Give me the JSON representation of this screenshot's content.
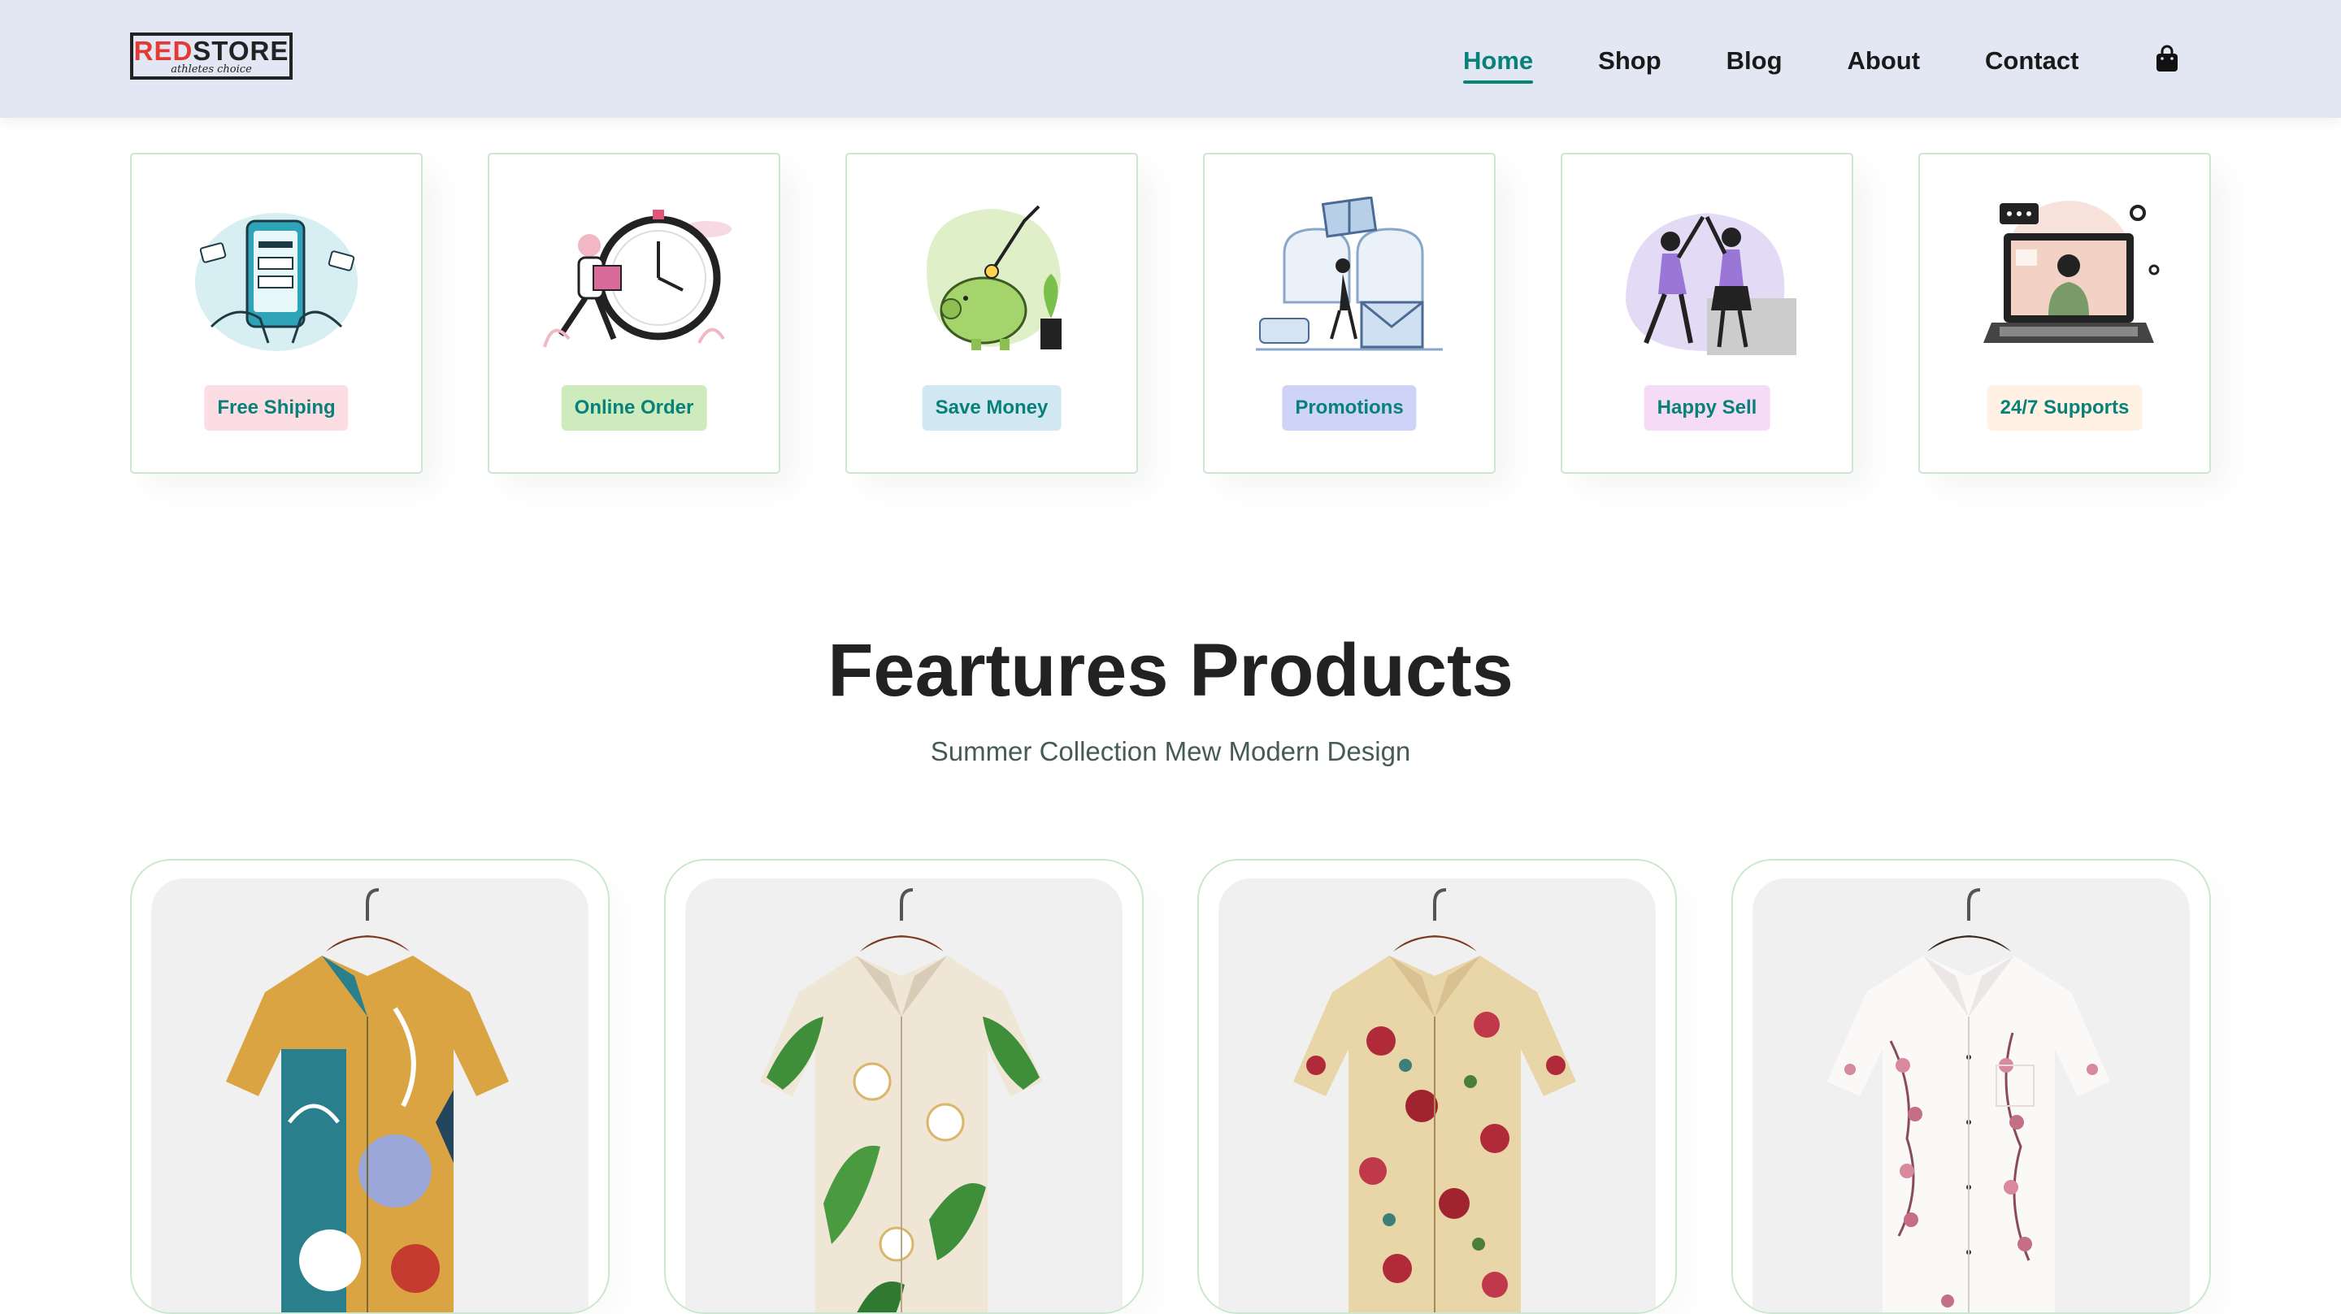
{
  "brand": {
    "logo_red": "RED",
    "logo_dark": "STORE",
    "logo_tagline": "athletes choice"
  },
  "nav": {
    "items": [
      "Home",
      "Shop",
      "Blog",
      "About",
      "Contact"
    ],
    "active": "Home",
    "cart_icon": "shopping-bag-icon"
  },
  "features": [
    {
      "label": "Free Shiping",
      "badge_color": "#fddde4",
      "icon": "phone-payment-illustration"
    },
    {
      "label": "Online Order",
      "badge_color": "#cdebbc",
      "icon": "stopwatch-delivery-illustration"
    },
    {
      "label": "Save Money",
      "badge_color": "#d1e8f2",
      "icon": "piggy-bank-illustration"
    },
    {
      "label": "Promotions",
      "badge_color": "#cdd4f8",
      "icon": "gift-promotion-illustration"
    },
    {
      "label": "Happy Sell",
      "badge_color": "#f6dbf6",
      "icon": "high-five-illustration"
    },
    {
      "label": "24/7 Supports",
      "badge_color": "#fff2e5",
      "icon": "laptop-support-illustration"
    }
  ],
  "section": {
    "title": "Feartures Products",
    "subtitle": "Summer Collection Mew Modern Design"
  },
  "products": [
    {
      "image": "abstract-print-shirt"
    },
    {
      "image": "tropical-leaf-shirt"
    },
    {
      "image": "floral-rose-shirt"
    },
    {
      "image": "white-blossom-shirt"
    }
  ],
  "colors": {
    "accent": "#088178",
    "header_bg": "#e3e6f3",
    "card_border": "#cce7d0"
  }
}
